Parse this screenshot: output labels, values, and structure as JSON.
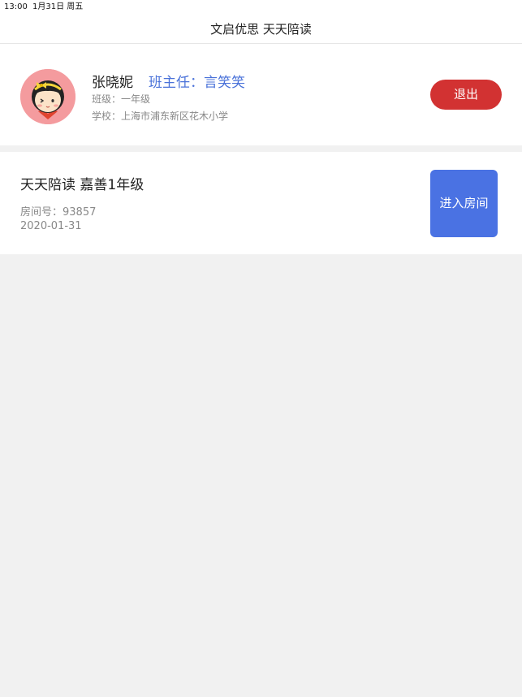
{
  "status_bar": {
    "time": "13:00",
    "date": "1月31日 周五"
  },
  "nav": {
    "title": "文启优思 天天陪读"
  },
  "profile": {
    "name": "张晓妮",
    "teacher": "班主任：言笑笑",
    "class_text": "班级：一年级",
    "school_text": "学校：上海市浦东新区花木小学",
    "logout_label": "退出"
  },
  "room": {
    "title": "天天陪读 嘉善1年级",
    "number_text": "房间号：93857",
    "date": "2020-01-31",
    "enter_label": "进入房间"
  },
  "colors": {
    "accent_blue": "#4a72e3",
    "teacher_blue": "#4a72d9",
    "logout_red": "#d23232",
    "background": "#f1f1f1",
    "avatar_bg": "#f49b9e"
  },
  "icons": {
    "avatar": "cartoon-girl-avatar"
  }
}
